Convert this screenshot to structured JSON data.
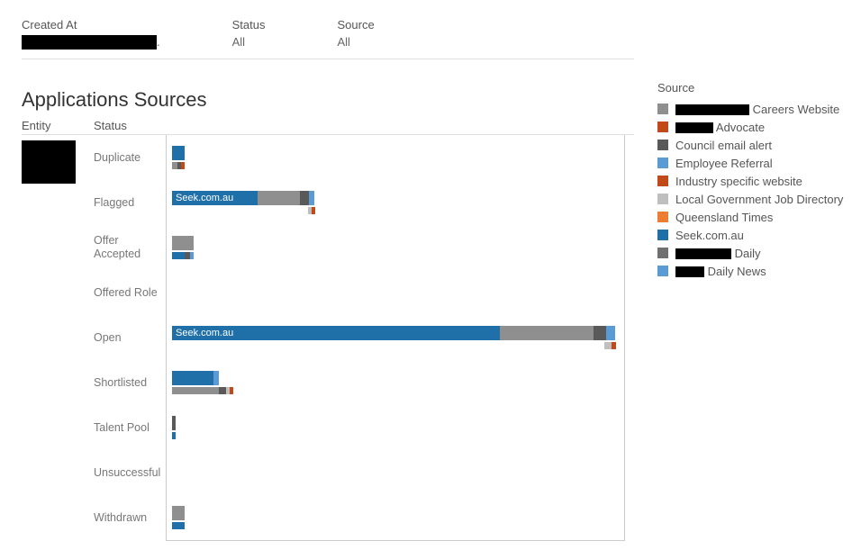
{
  "filters": {
    "createdAt": {
      "label": "Created At",
      "value": ""
    },
    "status": {
      "label": "Status",
      "value": "All"
    },
    "source": {
      "label": "Source",
      "value": "All"
    }
  },
  "title": "Applications Sources",
  "columns": {
    "entity": "Entity",
    "status": "Status"
  },
  "legend": {
    "title": "Source",
    "items": [
      {
        "key": "careers",
        "label": "Careers Website",
        "color": "#8f8f8f",
        "redactedPrefix": true,
        "redactWidth": 82
      },
      {
        "key": "advocate",
        "label": "Advocate",
        "color": "#c24a18",
        "redactedPrefix": true,
        "redactWidth": 42
      },
      {
        "key": "council",
        "label": "Council email alert",
        "color": "#595959",
        "redactedPrefix": false
      },
      {
        "key": "empref",
        "label": "Employee Referral",
        "color": "#5b9bd5",
        "redactedPrefix": false
      },
      {
        "key": "industry",
        "label": "Industry specific website",
        "color": "#c24a18",
        "redactedPrefix": false
      },
      {
        "key": "localgov",
        "label": "Local Government Job Directory",
        "color": "#bfbfbf",
        "redactedPrefix": false
      },
      {
        "key": "qldtimes",
        "label": "Queensland Times",
        "color": "#ed7d31",
        "redactedPrefix": false
      },
      {
        "key": "seek",
        "label": "Seek.com.au",
        "color": "#1f6fa8",
        "redactedPrefix": false
      },
      {
        "key": "daily1",
        "label": "Daily",
        "color": "#707070",
        "redactedPrefix": true,
        "redactWidth": 62
      },
      {
        "key": "daily2",
        "label": "Daily News",
        "color": "#5b9bd5",
        "redactedPrefix": true,
        "redactWidth": 32
      }
    ]
  },
  "chart_data": {
    "type": "bar",
    "xlabel": "",
    "ylabel": "",
    "title": "Applications Sources",
    "max": 500,
    "statuses": [
      "Duplicate",
      "Flagged",
      "Offer Accepted",
      "Offered Role",
      "Open",
      "Shortlisted",
      "Talent Pool",
      "Unsuccessful",
      "Withdrawn"
    ],
    "rows": [
      {
        "status": "Duplicate",
        "lines": [
          [
            {
              "key": "seek",
              "value": 14
            }
          ],
          [
            {
              "key": "careers",
              "value": 6
            },
            {
              "key": "council",
              "value": 4
            },
            {
              "key": "industry",
              "value": 3
            }
          ]
        ]
      },
      {
        "status": "Flagged",
        "lines": [
          [
            {
              "key": "seek",
              "value": 95,
              "label": "Seek.com.au"
            },
            {
              "key": "careers",
              "value": 48
            },
            {
              "key": "council",
              "value": 10
            },
            {
              "key": "empref",
              "value": 6
            }
          ],
          [
            {
              "key": "localgov",
              "value": 4
            },
            {
              "key": "industry",
              "value": 3
            }
          ]
        ]
      },
      {
        "status": "Offer Accepted",
        "lines": [
          [
            {
              "key": "careers",
              "value": 24
            }
          ],
          [
            {
              "key": "seek",
              "value": 14
            },
            {
              "key": "council",
              "value": 6
            },
            {
              "key": "empref",
              "value": 4
            }
          ]
        ]
      },
      {
        "status": "Offered Role",
        "lines": []
      },
      {
        "status": "Open",
        "lines": [
          [
            {
              "key": "seek",
              "value": 365,
              "label": "Seek.com.au"
            },
            {
              "key": "careers",
              "value": 105
            },
            {
              "key": "council",
              "value": 14
            },
            {
              "key": "empref",
              "value": 10
            }
          ],
          [
            {
              "key": "localgov",
              "value": 8
            },
            {
              "key": "industry",
              "value": 5
            }
          ]
        ]
      },
      {
        "status": "Shortlisted",
        "lines": [
          [
            {
              "key": "seek",
              "value": 46
            },
            {
              "key": "empref",
              "value": 6
            }
          ],
          [
            {
              "key": "careers",
              "value": 52
            },
            {
              "key": "council",
              "value": 8
            },
            {
              "key": "localgov",
              "value": 3
            },
            {
              "key": "industry",
              "value": 2
            }
          ]
        ]
      },
      {
        "status": "Talent Pool",
        "lines": [
          [
            {
              "key": "council",
              "value": 2
            }
          ],
          [
            {
              "key": "seek",
              "value": 4
            }
          ]
        ]
      },
      {
        "status": "Unsuccessful",
        "lines": []
      },
      {
        "status": "Withdrawn",
        "lines": [
          [
            {
              "key": "careers",
              "value": 14
            }
          ],
          [
            {
              "key": "seek",
              "value": 14
            }
          ]
        ]
      }
    ]
  }
}
